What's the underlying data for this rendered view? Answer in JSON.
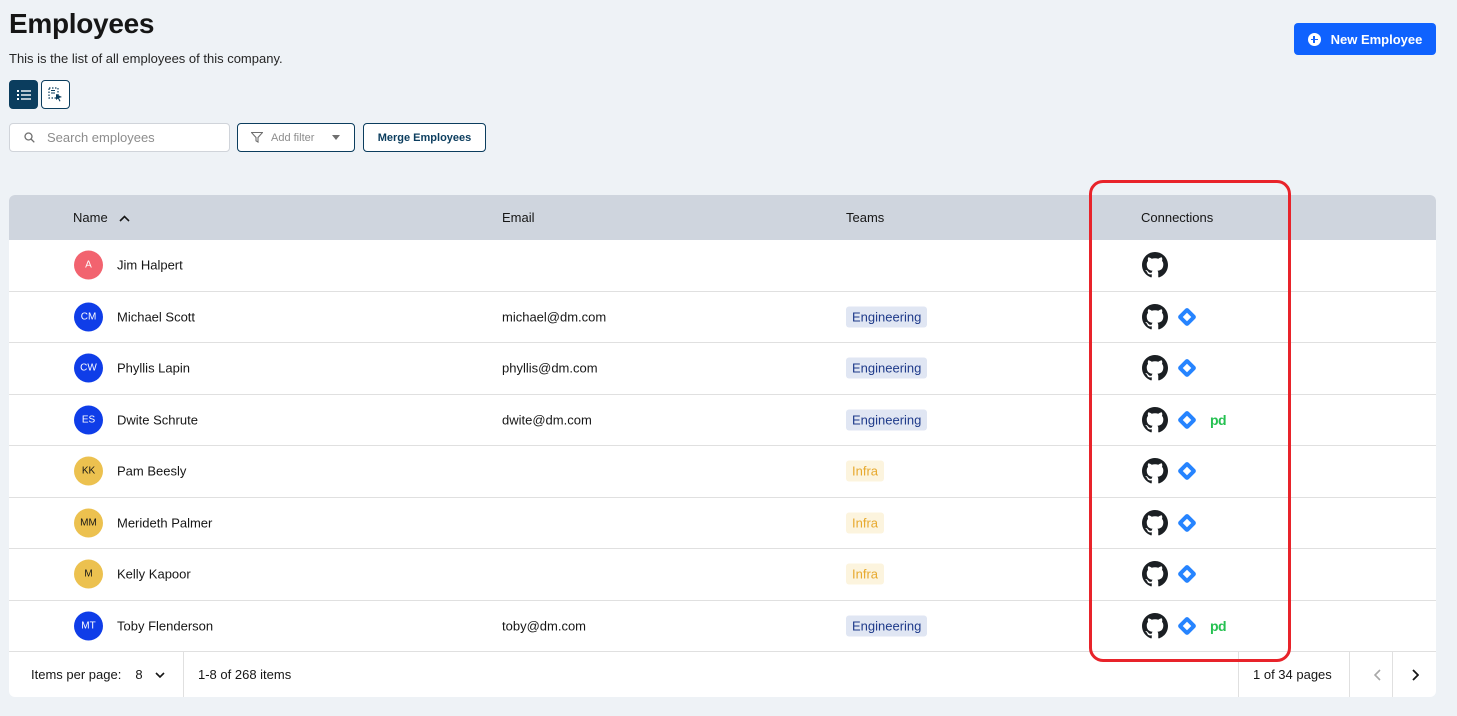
{
  "header": {
    "title": "Employees",
    "subtitle": "This is the list of all employees of this company.",
    "new_button_label": "New Employee"
  },
  "toolbar": {
    "search_placeholder": "Search employees",
    "filter_label": "Add filter",
    "merge_label": "Merge Employees"
  },
  "table": {
    "columns": {
      "name": "Name",
      "email": "Email",
      "teams": "Teams",
      "connections": "Connections"
    },
    "rows": [
      {
        "initials": "A",
        "avatar_color": "#f2636f",
        "name": "Jim Halpert",
        "email": "",
        "team": "",
        "connections": [
          "github-icon"
        ]
      },
      {
        "initials": "CM",
        "avatar_color": "#0f3de8",
        "name": "Michael Scott",
        "email": "michael@dm.com",
        "team": "Engineering",
        "connections": [
          "github-icon",
          "jira-icon"
        ]
      },
      {
        "initials": "CW",
        "avatar_color": "#0f3de8",
        "name": "Phyllis Lapin",
        "email": "phyllis@dm.com",
        "team": "Engineering",
        "connections": [
          "github-icon",
          "jira-icon"
        ]
      },
      {
        "initials": "ES",
        "avatar_color": "#0f3de8",
        "name": "Dwite Schrute",
        "email": "dwite@dm.com",
        "team": "Engineering",
        "connections": [
          "github-icon",
          "jira-icon",
          "pagerduty-icon"
        ]
      },
      {
        "initials": "KK",
        "avatar_color": "#ecc14f",
        "name": "Pam Beesly",
        "email": "",
        "team": "Infra",
        "connections": [
          "github-icon",
          "jira-icon"
        ]
      },
      {
        "initials": "MM",
        "avatar_color": "#ecc14f",
        "name": "Merideth Palmer",
        "email": "",
        "team": "Infra",
        "connections": [
          "github-icon",
          "jira-icon"
        ]
      },
      {
        "initials": "M",
        "avatar_color": "#ecc14f",
        "name": "Kelly Kapoor",
        "email": "",
        "team": "Infra",
        "connections": [
          "github-icon",
          "jira-icon"
        ]
      },
      {
        "initials": "MT",
        "avatar_color": "#0f3de8",
        "name": "Toby Flenderson",
        "email": "toby@dm.com",
        "team": "Engineering",
        "connections": [
          "github-icon",
          "jira-icon",
          "pagerduty-icon"
        ]
      }
    ],
    "pagerduty_text": "pd"
  },
  "pagination": {
    "items_per_page_label": "Items per page:",
    "items_per_page_value": "8",
    "range_text": "1-8 of 268 items",
    "pages_text": "1 of 34 pages"
  },
  "colors": {
    "primary": "#0f62fe",
    "highlight": "#e8232a",
    "eng_tag_bg": "#e0e6f3",
    "infra_tag_bg": "#fcf4de"
  }
}
